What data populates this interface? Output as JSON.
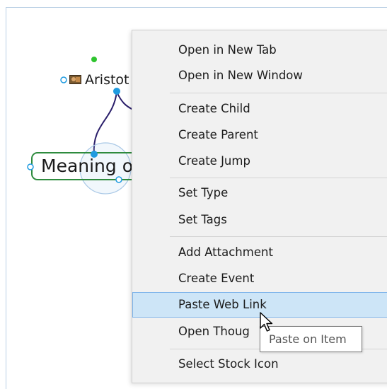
{
  "mindmap": {
    "nodes": [
      {
        "label": "Aristot",
        "icon": "photo-thumbnail-icon"
      },
      {
        "label": "Meaning o"
      }
    ],
    "colors": {
      "link": "#2b1f6b",
      "node_border": "#2e8b3e",
      "anchor": "#1f9be0",
      "parent_dot": "#2ec42e"
    }
  },
  "context_menu": {
    "groups": [
      [
        "Open in New Tab",
        "Open in New Window"
      ],
      [
        "Create Child",
        "Create Parent",
        "Create Jump"
      ],
      [
        "Set Type",
        "Set Tags"
      ],
      [
        "Add Attachment",
        "Create Event",
        "Paste Web Link",
        "Open Thoug"
      ],
      [
        "Select Stock Icon"
      ]
    ],
    "highlighted_item": "Paste Web Link",
    "colors": {
      "background": "#f1f1f1",
      "highlight_bg": "#cde5f7",
      "highlight_border": "#7eb4ea"
    }
  },
  "tooltip": {
    "text": "Paste on Item"
  },
  "cursor": {
    "icon": "arrow-pointer-icon"
  }
}
